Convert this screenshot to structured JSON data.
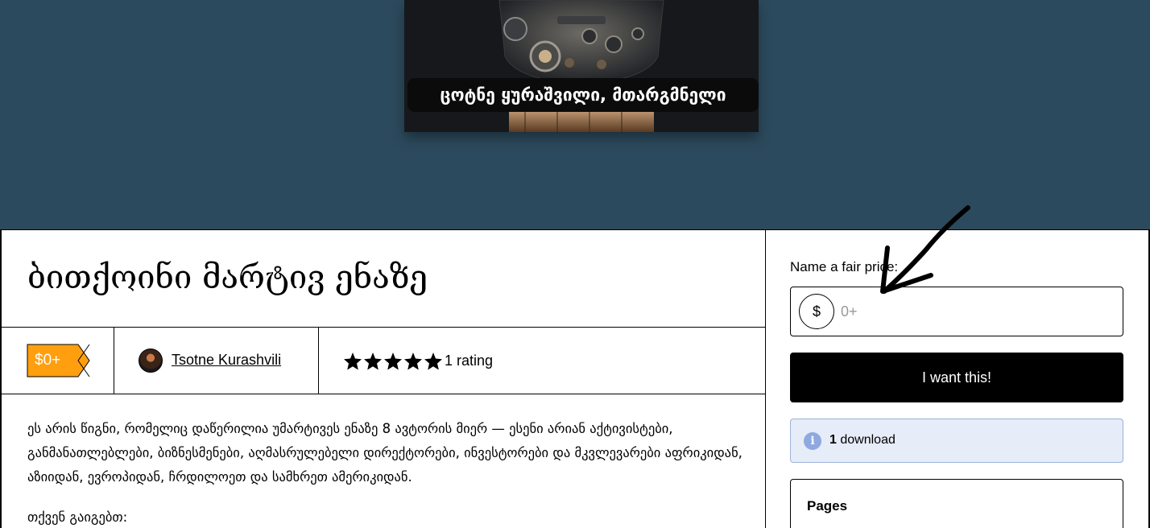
{
  "cover": {
    "caption": "ცოტნე ყურაშვილი, მთარგმნელი"
  },
  "product": {
    "title": "ბითქოინი მარტივ ენაზე",
    "price_tag": "$0+",
    "author": "Tsotne Kurashvili",
    "rating_text": "1 rating",
    "stars": 5
  },
  "description": {
    "paragraph_1": "ეს არის წიგნი, რომელიც დაწერილია უმარტივეს ენაზე 8 ავტორის მიერ — ესენი არიან აქტივისტები, განმანათლებლები, ბიზნესმენები, აღმასრულებელი დირექტორები, ინვესტორები და მკვლევარები აფრიკიდან, აზიიდან, ევროპიდან, ჩრდილოეთ და სამხრეთ ამერიკიდან.",
    "paragraph_2": "თქვენ გაიგებთ:"
  },
  "purchase": {
    "fair_price_label": "Name a fair price:",
    "currency_symbol": "$",
    "price_placeholder": "0+",
    "button_label": "I want this!",
    "downloads_count": "1",
    "downloads_label": "download",
    "pages_title": "Pages"
  },
  "colors": {
    "hero_bg": "#2c4a5d",
    "price_tag": "#ff9f0f",
    "info_bg": "#e6ecf8"
  }
}
